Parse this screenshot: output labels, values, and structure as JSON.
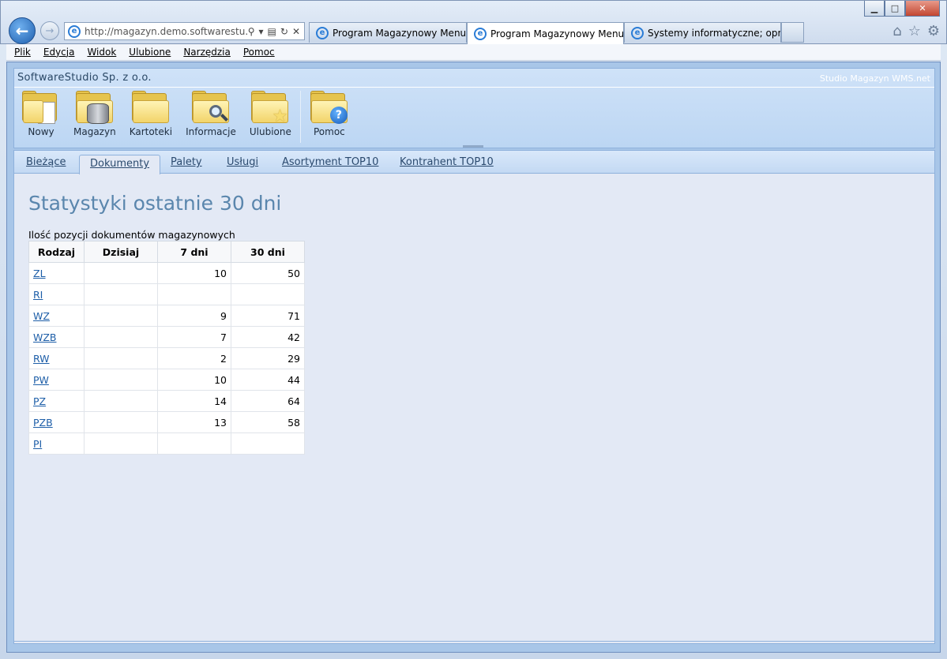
{
  "browser": {
    "address_url": "http://magazyn.demo.softwarestu...",
    "tabs": [
      {
        "title": "Program Magazynowy Menu"
      },
      {
        "title": "Program Magazynowy Menu",
        "close": "✕"
      },
      {
        "title": "Systemy informatyczne; oprog..."
      }
    ],
    "window_buttons": {
      "minimize": "▁",
      "maximize": "□",
      "close": "✕"
    },
    "icons": [
      "home-icon",
      "star-icon",
      "gear-icon"
    ]
  },
  "menubar": {
    "items": [
      "Plik",
      "Edycja",
      "Widok",
      "Ulubione",
      "Narzędzia",
      "Pomoc"
    ]
  },
  "app": {
    "company": "SoftwareStudio Sp. z o.o.",
    "product": "Studio Magazyn WMS.net",
    "toolbar": [
      {
        "label": "Nowy",
        "icon": "new-document-icon"
      },
      {
        "label": "Magazyn",
        "icon": "database-icon"
      },
      {
        "label": "Kartoteki",
        "icon": "folder-icon"
      },
      {
        "label": "Informacje",
        "icon": "magnifier-icon"
      },
      {
        "label": "Ulubione",
        "icon": "star-icon"
      },
      {
        "label": "Pomoc",
        "icon": "help-icon"
      }
    ],
    "tabs": [
      {
        "label": "Bieżące"
      },
      {
        "label": "Dokumenty",
        "active": true
      },
      {
        "label": "Palety"
      },
      {
        "label": "Usługi"
      },
      {
        "label": "Asortyment TOP10"
      },
      {
        "label": "Kontrahent TOP10"
      }
    ],
    "page_title": "Statystyki ostatnie 30 dni",
    "stats_caption": "Ilość pozycji dokumentów magazynowych",
    "table": {
      "headers": [
        "Rodzaj",
        "Dzisiaj",
        "7 dni",
        "30 dni"
      ],
      "rows": [
        {
          "rodzaj": "ZL",
          "dzisiaj": "",
          "d7": "10",
          "d30": "50"
        },
        {
          "rodzaj": "RI",
          "dzisiaj": "",
          "d7": "",
          "d30": ""
        },
        {
          "rodzaj": "WZ",
          "dzisiaj": "",
          "d7": "9",
          "d30": "71"
        },
        {
          "rodzaj": "WZB",
          "dzisiaj": "",
          "d7": "7",
          "d30": "42"
        },
        {
          "rodzaj": "RW",
          "dzisiaj": "",
          "d7": "2",
          "d30": "29"
        },
        {
          "rodzaj": "PW",
          "dzisiaj": "",
          "d7": "10",
          "d30": "44"
        },
        {
          "rodzaj": "PZ",
          "dzisiaj": "",
          "d7": "14",
          "d30": "64"
        },
        {
          "rodzaj": "PZB",
          "dzisiaj": "",
          "d7": "13",
          "d30": "58"
        },
        {
          "rodzaj": "PI",
          "dzisiaj": "",
          "d7": "",
          "d30": ""
        }
      ]
    }
  }
}
